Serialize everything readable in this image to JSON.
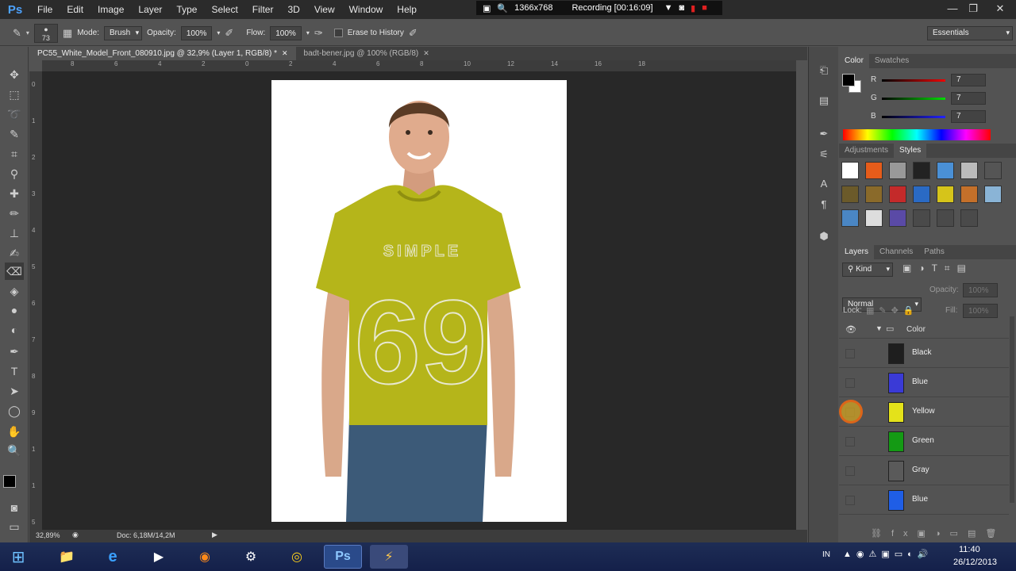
{
  "app": {
    "logo": "Ps"
  },
  "menu": [
    "File",
    "Edit",
    "Image",
    "Layer",
    "Type",
    "Select",
    "Filter",
    "3D",
    "View",
    "Window",
    "Help"
  ],
  "recorder": {
    "resolution": "1366x768",
    "status": "Recording [00:16:09]"
  },
  "options": {
    "brush_size": "73",
    "mode_label": "Mode:",
    "mode_value": "Brush",
    "opacity_label": "Opacity:",
    "opacity_value": "100%",
    "flow_label": "Flow:",
    "flow_value": "100%",
    "erase_history_label": "Erase to History",
    "workspace": "Essentials"
  },
  "tabs": [
    {
      "label": "PC55_White_Model_Front_080910.jpg @ 32,9% (Layer 1, RGB/8) *",
      "active": true
    },
    {
      "label": "badt-bener.jpg @ 100% (RGB/8)",
      "active": false
    }
  ],
  "ruler": {
    "h": [
      "8",
      "6",
      "4",
      "2",
      "0",
      "2",
      "4",
      "6",
      "8",
      "10",
      "12",
      "14",
      "16",
      "18"
    ],
    "v": [
      "0",
      "1",
      "2",
      "3",
      "4",
      "5",
      "6",
      "7",
      "8",
      "9",
      "1",
      "1",
      "5"
    ]
  },
  "shirt": {
    "text_top": "SIMPLE",
    "number": "69",
    "color": "#b5b51a"
  },
  "status": {
    "zoom": "32,89%",
    "doc": "Doc: 6,18M/14,2M"
  },
  "color_panel": {
    "tabs": [
      "Color",
      "Swatches"
    ],
    "r_label": "R",
    "r_value": "7",
    "g_label": "G",
    "g_value": "7",
    "b_label": "B",
    "b_value": "7"
  },
  "adjust_panel": {
    "tabs": [
      "Adjustments",
      "Styles"
    ]
  },
  "layers_panel": {
    "tabs": [
      "Layers",
      "Channels",
      "Paths"
    ],
    "kind": "Kind",
    "blend": "Normal",
    "opacity_label": "Opacity:",
    "opacity_value": "100%",
    "lock_label": "Lock:",
    "fill_label": "Fill:",
    "fill_value": "100%",
    "group": "Color",
    "layers": [
      {
        "name": "Black",
        "color": "#1e1e1e"
      },
      {
        "name": "Blue",
        "color": "#3a3ad6"
      },
      {
        "name": "Yellow",
        "color": "#e4e21a"
      },
      {
        "name": "Green",
        "color": "#149a14"
      },
      {
        "name": "Gray",
        "color": "#5a5a5a"
      },
      {
        "name": "Blue",
        "color": "#1f5ee6"
      }
    ]
  },
  "taskbar": {
    "lang": "IN",
    "time": "11:40",
    "date": "26/12/2013"
  }
}
